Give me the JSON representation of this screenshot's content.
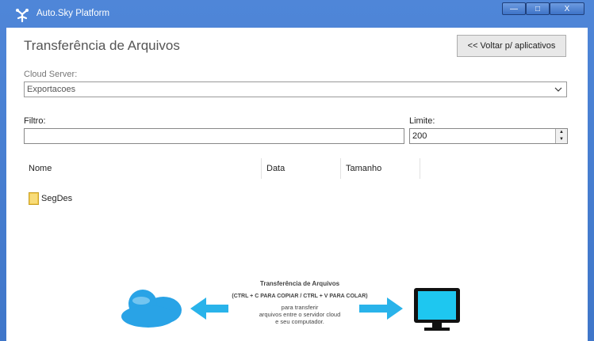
{
  "window": {
    "title": "Auto.Sky Platform",
    "controls": {
      "minimize": "—",
      "maximize": "□",
      "close": "X"
    }
  },
  "header": {
    "title": "Transferência de Arquivos",
    "back_button": "<< Voltar p/ aplicativos"
  },
  "cloud_server": {
    "label": "Cloud Server:",
    "value": "Exportacoes"
  },
  "filter": {
    "label": "Filtro:",
    "value": ""
  },
  "limit": {
    "label": "Limite:",
    "value": "200"
  },
  "file_list": {
    "columns": [
      "Nome",
      "Data",
      "Tamanho"
    ],
    "rows": [
      {
        "name": "SegDes",
        "type": "folder"
      }
    ]
  },
  "banner": {
    "title": "Transferência de Arquivos",
    "shortcuts": "(CTRL + C PARA COPIAR / CTRL + V PARA COLAR)",
    "description_lines": [
      "para transferir",
      "arquivos entre o servidor cloud",
      "e seu computador."
    ]
  },
  "colors": {
    "title_bar": "#4f86d8",
    "cloud": "#29a3e6",
    "monitor_screen": "#1ec7f0",
    "arrow": "#29b3ea",
    "folder": "#f2c94c"
  },
  "icons": [
    "app-logo-icon",
    "chevron-down-icon",
    "folder-icon",
    "cloud-icon",
    "arrow-left-icon",
    "arrow-right-icon",
    "monitor-icon"
  ]
}
